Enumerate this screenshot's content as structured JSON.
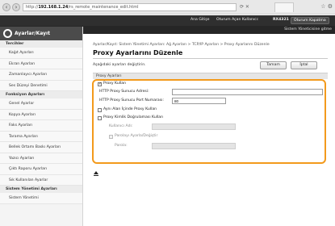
{
  "browser": {
    "url_scheme": "http://",
    "url_host": "192.168.1.24",
    "url_path": "/rs_remote_maintenance_edit.html",
    "back_icon": "arrow-left-icon",
    "forward_icon": "arrow-right-icon"
  },
  "topbar": {
    "home": "Ana Gitişe",
    "logout": "Oturum Açan Kullanıcı:",
    "user": "RX4321",
    "session": "Oturum Kapatma",
    "mode": "Sistem Yöneticisine gitme"
  },
  "sidebar": {
    "title": "Ayarlar/Kayıt",
    "sections": [
      {
        "label": "Tercihler",
        "items": [
          "Kağıt Ayarları",
          "Ekran Ayarları",
          "Zamanlayıcı Ayarları",
          "Ses Düzeyi Denetimi"
        ]
      },
      {
        "label": "Fonksiyon Ayarları",
        "items": [
          "Genel Ayarlar",
          "Kopya Ayarları",
          "Faks Ayarları",
          "Tarama Ayarları",
          "Bellek Ortamı Baskı Ayarları",
          "Yazıcı Ayarları",
          "Çıktı Raporu Ayarları",
          "Sık Kullanılan Ayarlar"
        ]
      },
      {
        "label": "Sistem Yönetimi Ayarları",
        "items": [
          "Sistem Yönetimi"
        ]
      }
    ]
  },
  "main": {
    "breadcrumb": "Ayarlar/Kayıt: Sistem Yönetimi Ayarları: Ağ Ayarları > TCP/IP Ayarları > Proxy Ayarlarını Düzenle",
    "title": "Proxy Ayarlarını Düzenle",
    "instruction": "Aşağıdaki ayarları değiştirin.",
    "ok_label": "Tamam",
    "cancel_label": "İptal",
    "section_label": "Proxy Ayarları",
    "use_proxy": "Proxy Kullan",
    "http_address_label": "HTTP Proxy Sunucu Adresi:",
    "http_address_value": "",
    "http_port_label": "HTTP Proxy Sunucu Port Numarası:",
    "http_port_value": "80",
    "same_domain": "Aynı Alan İçinde Proxy Kullan",
    "use_auth": "Proxy Kimlik Doğrulaması Kullan",
    "username_label": "Kullanıcı Adı:",
    "username_value": "",
    "confirm_password": "Parolayı Ayarla/Değiştir",
    "password_label": "Parola:",
    "password_value": ""
  }
}
